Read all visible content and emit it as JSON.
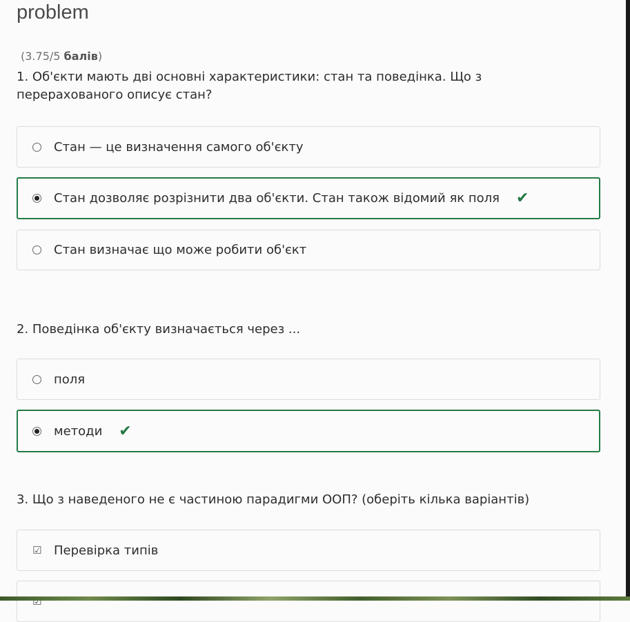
{
  "header": {
    "title": "problem"
  },
  "score": {
    "value": "(3.75/5",
    "label": "балів",
    "close": ")"
  },
  "questions": [
    {
      "text": "1. Об'єкти мають дві основні характеристики: стан та поведінка. Що з перерахованого описує стан?",
      "options": [
        {
          "label": "Стан — це визначення самого об'єкту",
          "selected": false,
          "correct": false
        },
        {
          "label": "Стан дозволяє розрізнити два об'єкти. Стан також відомий як поля",
          "selected": true,
          "correct": true
        },
        {
          "label": "Стан визначає що може робити об'єкт",
          "selected": false,
          "correct": false
        }
      ]
    },
    {
      "text": "2. Поведінка об'єкту визначається через ...",
      "options": [
        {
          "label": "поля",
          "selected": false,
          "correct": false
        },
        {
          "label": "методи",
          "selected": true,
          "correct": true
        }
      ]
    },
    {
      "text": "3. Що з наведеного не є частиною парадигми ООП? (оберіть кілька варіантів)",
      "options": [
        {
          "label": "Перевірка типів",
          "selected": true,
          "correct": false
        },
        {
          "label": "",
          "selected": true,
          "correct": false
        }
      ]
    }
  ],
  "icons": {
    "check": "check-icon",
    "radio": "radio-icon",
    "checkbox": "checkbox-icon"
  },
  "colors": {
    "correct_border": "#237a44",
    "option_border": "#dcdcdc"
  }
}
